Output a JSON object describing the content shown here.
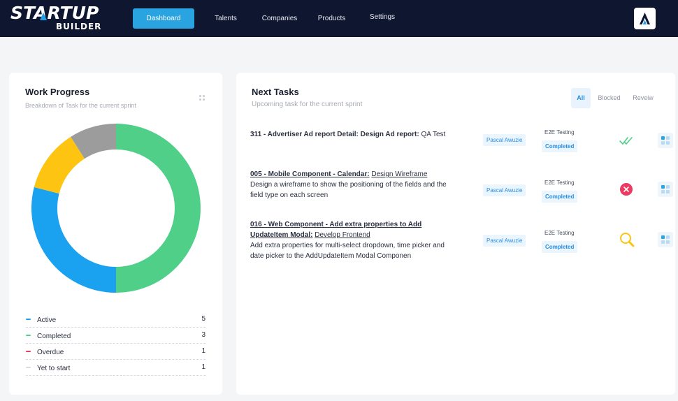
{
  "brand": {
    "line1": "STARTUP",
    "line2": "BUILDER"
  },
  "nav": {
    "items": [
      {
        "label": "Dashboard",
        "active": true
      },
      {
        "label": "Talents",
        "active": false
      },
      {
        "label": "Companies",
        "active": false
      },
      {
        "label": "Products",
        "active": false
      },
      {
        "label": "Settings",
        "active": false
      }
    ]
  },
  "work_progress": {
    "title": "Work Progress",
    "subtitle": "Breakdown of Task for the current sprint",
    "legend": [
      {
        "label": "Active",
        "count": "5",
        "color": "#1aa1f0"
      },
      {
        "label": "Completed",
        "count": "3",
        "color": "#4fcf88"
      },
      {
        "label": "Overdue",
        "count": "1",
        "color": "#ec3a62"
      },
      {
        "label": "Yet to start",
        "count": "1",
        "color": "#d9dbe0"
      }
    ],
    "donut": [
      {
        "label": "Completed",
        "value": 50,
        "color": "#4fcf88"
      },
      {
        "label": "Active",
        "value": 29,
        "color": "#1aa1f0"
      },
      {
        "label": "Overdue",
        "value": 12,
        "color": "#fdc412"
      },
      {
        "label": "Yet to start",
        "value": 9,
        "color": "#9c9c9c"
      }
    ]
  },
  "next_tasks": {
    "title": "Next Tasks",
    "subtitle": "Upcoming task for the current sprint",
    "filters": [
      {
        "label": "All",
        "active": true
      },
      {
        "label": "Blocked",
        "active": false
      },
      {
        "label": "Reveiw",
        "active": false
      }
    ],
    "tasks": [
      {
        "title": "311 - Advertiser Ad report Detail: Design Ad report:",
        "title_rest": "QA Test",
        "description": "",
        "assignee": "Pascal Awuzie",
        "type": "E2E Testing",
        "status": "Completed",
        "status_icon": "double-check-icon"
      },
      {
        "title": "005 - Mobile Component - Calendar:",
        "title_rest": "Design Wireframe",
        "description": "Design a wireframe to show the positioning of the fields and the field type on each screen",
        "assignee": "Pascal Awuzie",
        "type": "E2E Testing",
        "status": "Completed",
        "status_icon": "blocked-x-icon"
      },
      {
        "title": "016 - Web Component - Add extra properties to Add UpdateItem Modal:",
        "title_rest": "Develop Frontend",
        "description": "Add extra properties for multi-select dropdown, time picker and date picker to the AddUpdateItem Modal Componen",
        "assignee": "Pascal Awuzie",
        "type": "E2E Testing",
        "status": "Completed",
        "status_icon": "review-search-icon"
      }
    ]
  },
  "colors": {
    "navbar": "#0f1630",
    "accent": "#2aa3e1",
    "completed": "#4fcf88",
    "active": "#1aa1f0",
    "overdue": "#ec3a62",
    "warning": "#fdc412"
  }
}
